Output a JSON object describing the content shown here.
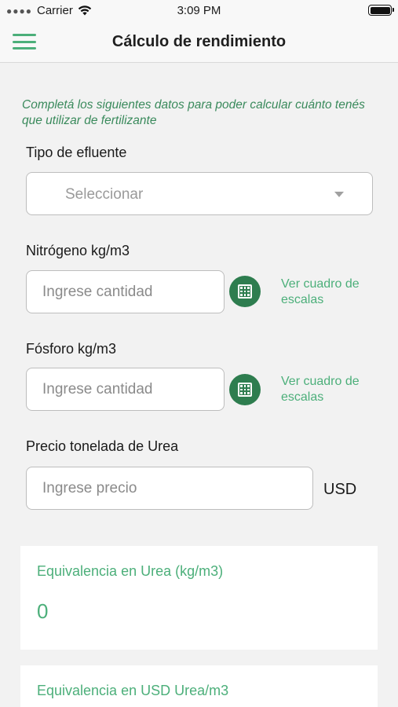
{
  "status_bar": {
    "carrier": "Carrier",
    "time": "3:09 PM"
  },
  "nav": {
    "title": "Cálculo de rendimiento"
  },
  "intro": "Completá los siguientes datos para poder calcular cuánto tenés que utilizar de fertilizante",
  "effluent": {
    "label": "Tipo de efluente",
    "value": "Seleccionar"
  },
  "nitrogen": {
    "label": "Nitrógeno kg/m3",
    "placeholder": "Ingrese cantidad",
    "link": "Ver cuadro de escalas"
  },
  "phosphorus": {
    "label": "Fósforo kg/m3",
    "placeholder": "Ingrese cantidad",
    "link": "Ver cuadro de escalas"
  },
  "urea_price": {
    "label": "Precio tonelada de Urea",
    "placeholder": "Ingrese precio",
    "currency": "USD"
  },
  "results": [
    {
      "title": "Equivalencia en Urea (kg/m3)",
      "value": "0"
    },
    {
      "title": "Equivalencia en USD Urea/m3"
    }
  ],
  "colors": {
    "accent": "#4caf7a",
    "accent_dark": "#2e7d4f",
    "intro_text": "#3a8a5c",
    "background": "#f2f2f2"
  },
  "icons": {
    "menu": "hamburger-menu-icon",
    "calculator": "calculator-grid-icon",
    "dropdown": "caret-down-icon",
    "wifi": "wifi-icon",
    "battery": "battery-icon"
  }
}
